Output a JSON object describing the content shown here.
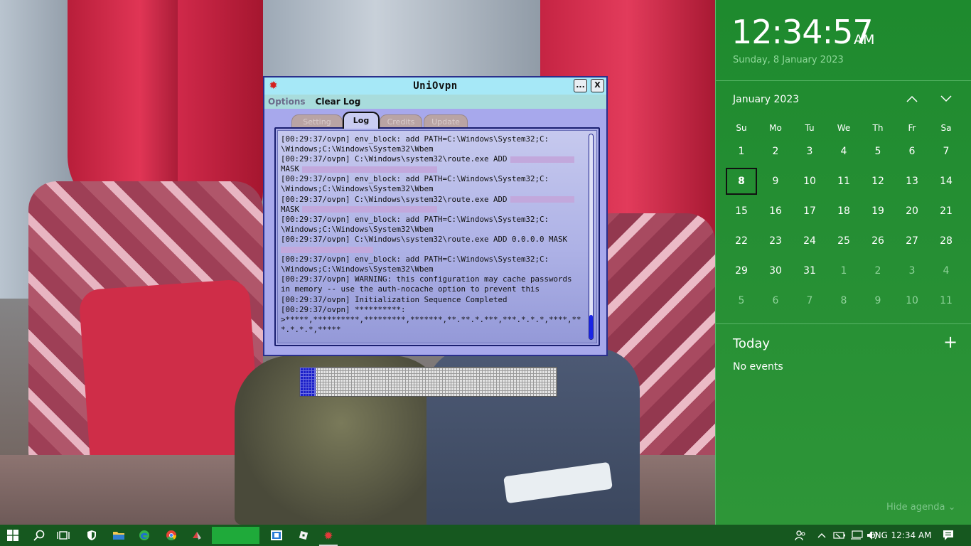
{
  "vpn_window": {
    "title": "UniOvpn",
    "min_label": "...",
    "close_label": "X",
    "menu": {
      "options": "Options",
      "clear_log": "Clear Log"
    },
    "tabs": [
      "Setting",
      "Log",
      "Credits",
      "Update"
    ],
    "active_tab": "Log",
    "log_lines": [
      "[00:29:37/ovpn] env_block: add PATH=C:\\Windows\\System32;C:",
      "\\Windows;C:\\Windows\\System32\\Wbem",
      "[00:29:37/ovpn] C:\\Windows\\system32\\route.exe ADD",
      "MASK",
      "[00:29:37/ovpn] env_block: add PATH=C:\\Windows\\System32;C:",
      "\\Windows;C:\\Windows\\System32\\Wbem",
      "[00:29:37/ovpn] C:\\Windows\\system32\\route.exe ADD",
      "MASK",
      "[00:29:37/ovpn] env_block: add PATH=C:\\Windows\\System32;C:",
      "\\Windows;C:\\Windows\\System32\\Wbem",
      "[00:29:37/ovpn] C:\\Windows\\system32\\route.exe ADD 0.0.0.0 MASK",
      "",
      "[00:29:37/ovpn] env_block: add PATH=C:\\Windows\\System32;C:",
      "\\Windows;C:\\Windows\\System32\\Wbem",
      "[00:29:37/ovpn] WARNING: this configuration may cache passwords",
      "in memory -- use the auth-nocache option to prevent this",
      "[00:29:37/ovpn] Initialization Sequence Completed",
      "[00:29:37/ovpn] **********:",
      ">*****,**********,*********,*******,**.**.*.***,***.*.*.*,****,**",
      "*.*.*.*,*****"
    ],
    "progress_fraction": 0.06
  },
  "flyout": {
    "time": "12:34:57",
    "ampm": "AM",
    "date_long": "Sunday, 8 January 2023",
    "month_label": "January 2023",
    "nav_up_icon": "chevron-up-icon",
    "nav_down_icon": "chevron-down-icon",
    "weekdays": [
      "Su",
      "Mo",
      "Tu",
      "We",
      "Th",
      "Fr",
      "Sa"
    ],
    "days": [
      {
        "d": "1",
        "cur": true
      },
      {
        "d": "2",
        "cur": true
      },
      {
        "d": "3",
        "cur": true
      },
      {
        "d": "4",
        "cur": true
      },
      {
        "d": "5",
        "cur": true
      },
      {
        "d": "6",
        "cur": true
      },
      {
        "d": "7",
        "cur": true
      },
      {
        "d": "8",
        "cur": true,
        "today": true
      },
      {
        "d": "9",
        "cur": true
      },
      {
        "d": "10",
        "cur": true
      },
      {
        "d": "11",
        "cur": true
      },
      {
        "d": "12",
        "cur": true
      },
      {
        "d": "13",
        "cur": true
      },
      {
        "d": "14",
        "cur": true
      },
      {
        "d": "15",
        "cur": true
      },
      {
        "d": "16",
        "cur": true
      },
      {
        "d": "17",
        "cur": true
      },
      {
        "d": "18",
        "cur": true
      },
      {
        "d": "19",
        "cur": true
      },
      {
        "d": "20",
        "cur": true
      },
      {
        "d": "21",
        "cur": true
      },
      {
        "d": "22",
        "cur": true
      },
      {
        "d": "23",
        "cur": true
      },
      {
        "d": "24",
        "cur": true
      },
      {
        "d": "25",
        "cur": true
      },
      {
        "d": "26",
        "cur": true
      },
      {
        "d": "27",
        "cur": true
      },
      {
        "d": "28",
        "cur": true
      },
      {
        "d": "29",
        "cur": true
      },
      {
        "d": "30",
        "cur": true
      },
      {
        "d": "31",
        "cur": true
      },
      {
        "d": "1",
        "cur": false
      },
      {
        "d": "2",
        "cur": false
      },
      {
        "d": "3",
        "cur": false
      },
      {
        "d": "4",
        "cur": false
      },
      {
        "d": "5",
        "cur": false
      },
      {
        "d": "6",
        "cur": false
      },
      {
        "d": "7",
        "cur": false
      },
      {
        "d": "8",
        "cur": false
      },
      {
        "d": "9",
        "cur": false
      },
      {
        "d": "10",
        "cur": false
      },
      {
        "d": "11",
        "cur": false
      }
    ],
    "today_label": "Today",
    "add_event_label": "+",
    "no_events": "No events",
    "hide_agenda": "Hide agenda"
  },
  "taskbar": {
    "language": "ENG",
    "time": "12:34 AM",
    "icons": [
      "windows-start-icon",
      "search-icon",
      "task-view-icon",
      "shield-icon",
      "file-explorer-icon",
      "edge-icon",
      "chrome-icon",
      "app-icon",
      "outlook-icon",
      "roblox-icon",
      "uniovpn-icon"
    ]
  },
  "colors": {
    "flyout_bg": "#268f34",
    "taskbar_bg": "#16581f",
    "window_title_bg": "#a6e8f7",
    "window_body": "#a7a8ec",
    "progress_fill": "#1a1ec8",
    "scroll_thumb": "#1a24e6"
  }
}
